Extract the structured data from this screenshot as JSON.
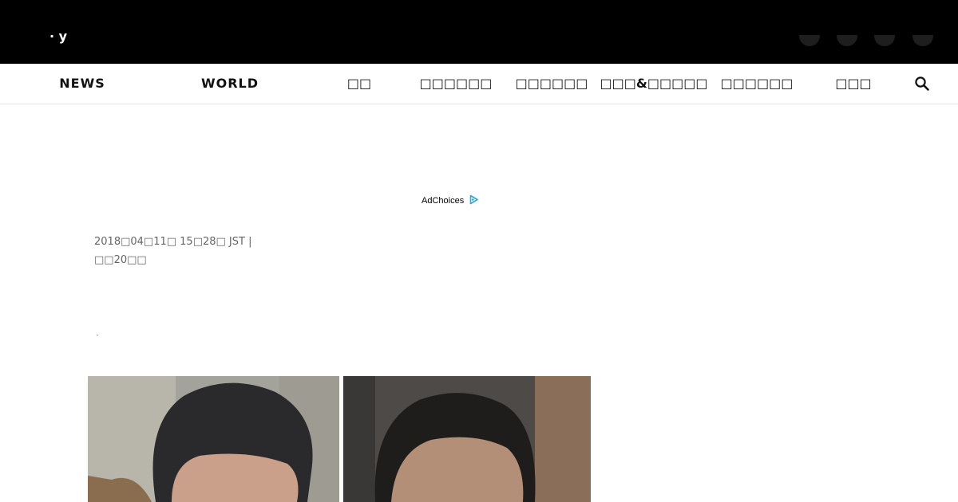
{
  "header": {
    "logo_fragment": "· y"
  },
  "nav": {
    "items": [
      {
        "label": "NEWS",
        "latin": true
      },
      {
        "label": "WORLD",
        "latin": true
      },
      {
        "label": "□□"
      },
      {
        "label": "□□□□□□"
      },
      {
        "label": "□□□□□□"
      },
      {
        "label": "□□□&□□□□□"
      },
      {
        "label": "□□□□□□"
      },
      {
        "label": "□□□"
      }
    ]
  },
  "ad": {
    "adchoices_label": "AdChoices"
  },
  "article": {
    "dateline": "2018□04□11□ 15□28□ JST |",
    "byline": "□□20□□"
  },
  "icons": {
    "search": "search-icon",
    "adchoices": "adchoices-icon"
  },
  "colors": {
    "topbar": "#000000",
    "adchoices_accent": "#27a8e0"
  }
}
